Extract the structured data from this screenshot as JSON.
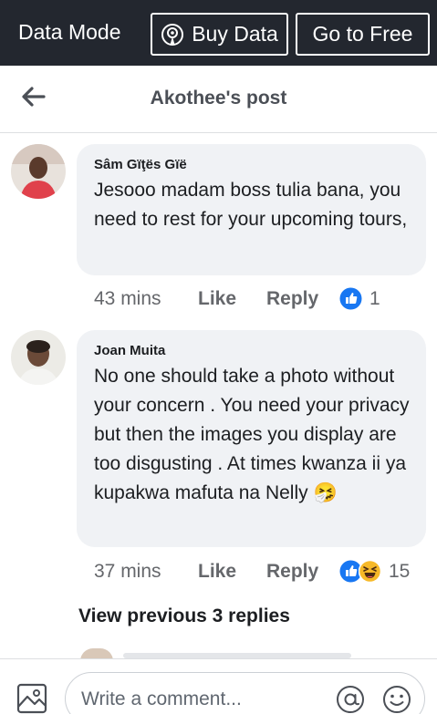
{
  "databar": {
    "mode_label": "Data Mode",
    "buy_label": "Buy Data",
    "free_label": "Go to Free"
  },
  "header": {
    "title": "Akothee's post"
  },
  "comments": [
    {
      "name": "Sâm Gïţës Gïë",
      "text": "Jesooo madam boss tulia bana, you need to rest for your upcoming tours,",
      "time": "43 mins",
      "like_label": "Like",
      "reply_label": "Reply",
      "reaction_count": "1",
      "reactions": [
        "like-reaction-icon"
      ]
    },
    {
      "name": "Joan Muita",
      "text": "No one should take a photo without your concern . You need your privacy but then the images you display are too disgusting . At times kwanza ii ya kupakwa mafuta na Nelly 🤧",
      "time": "37 mins",
      "like_label": "Like",
      "reply_label": "Reply",
      "reaction_count": "15",
      "reactions": [
        "like-reaction-icon",
        "haha-reaction-icon"
      ]
    }
  ],
  "view_previous": "View previous 3 replies",
  "composer": {
    "placeholder": "Write a comment..."
  },
  "colors": {
    "databar_bg": "#23272f",
    "like_blue": "#1877f2",
    "bubble_bg": "#f0f2f5"
  }
}
